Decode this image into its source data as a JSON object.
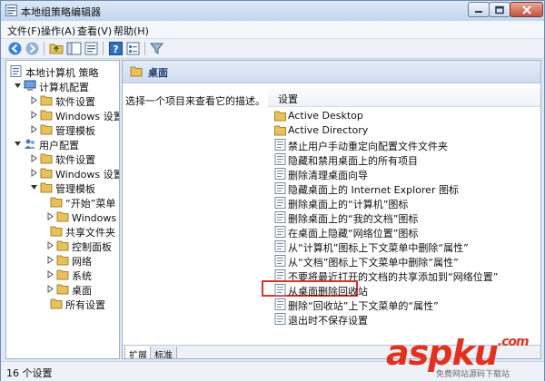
{
  "window": {
    "title": "本地组策略编辑器"
  },
  "menu": {
    "items": [
      "文件(F)",
      "操作(A)",
      "查看(V)",
      "帮助(H)"
    ]
  },
  "tree": {
    "items": [
      {
        "label": "本地计算机 策略"
      },
      {
        "label": "计算机配置"
      },
      {
        "label": "软件设置"
      },
      {
        "label": "Windows 设置"
      },
      {
        "label": "管理模板"
      },
      {
        "label": "用户配置"
      },
      {
        "label": "软件设置"
      },
      {
        "label": "Windows 设置"
      },
      {
        "label": "管理模板"
      },
      {
        "label": "“开始”菜单"
      },
      {
        "label": "Windows 组件"
      },
      {
        "label": "共享文件夹"
      },
      {
        "label": "控制面板"
      },
      {
        "label": "网络"
      },
      {
        "label": "系统"
      },
      {
        "label": "桌面"
      },
      {
        "label": "所有设置"
      }
    ]
  },
  "right": {
    "header_title": "桌面",
    "description": "选择一个项目来查看它的描述。",
    "column_header": "设置",
    "items": [
      {
        "label": "Active Desktop",
        "kind": "folder"
      },
      {
        "label": "Active Directory",
        "kind": "folder"
      },
      {
        "label": "禁止用户手动重定向配置文件文件夹",
        "kind": "policy"
      },
      {
        "label": "隐藏和禁用桌面上的所有项目",
        "kind": "policy"
      },
      {
        "label": "删除清理桌面向导",
        "kind": "policy"
      },
      {
        "label": "隐藏桌面上的 Internet Explorer 图标",
        "kind": "policy"
      },
      {
        "label": "删除桌面上的“计算机”图标",
        "kind": "policy"
      },
      {
        "label": "删除桌面上的“我的文档”图标",
        "kind": "policy"
      },
      {
        "label": "在桌面上隐藏“网络位置”图标",
        "kind": "policy"
      },
      {
        "label": "从“计算机”图标上下文菜单中删除“属性”",
        "kind": "policy"
      },
      {
        "label": "从“文档”图标上下文菜单中删除“属性”",
        "kind": "policy"
      },
      {
        "label": "不要将最近打开的文档的共享添加到“网络位置”",
        "kind": "policy"
      },
      {
        "label": "从桌面删除回收站",
        "kind": "policy"
      },
      {
        "label": "删除“回收站”上下文菜单的“属性”",
        "kind": "policy"
      },
      {
        "label": "退出时不保存设置",
        "kind": "policy"
      }
    ],
    "tabs": [
      "扩展",
      "标准"
    ]
  },
  "status": {
    "text": "16 个设置"
  },
  "watermark": {
    "brand": "aspku",
    "tld": ".com",
    "sub": "免费网站源码下载站"
  },
  "colors": {
    "highlight": "#d9342b",
    "folder": "#e8c15a",
    "watermark": "#e2321f"
  }
}
